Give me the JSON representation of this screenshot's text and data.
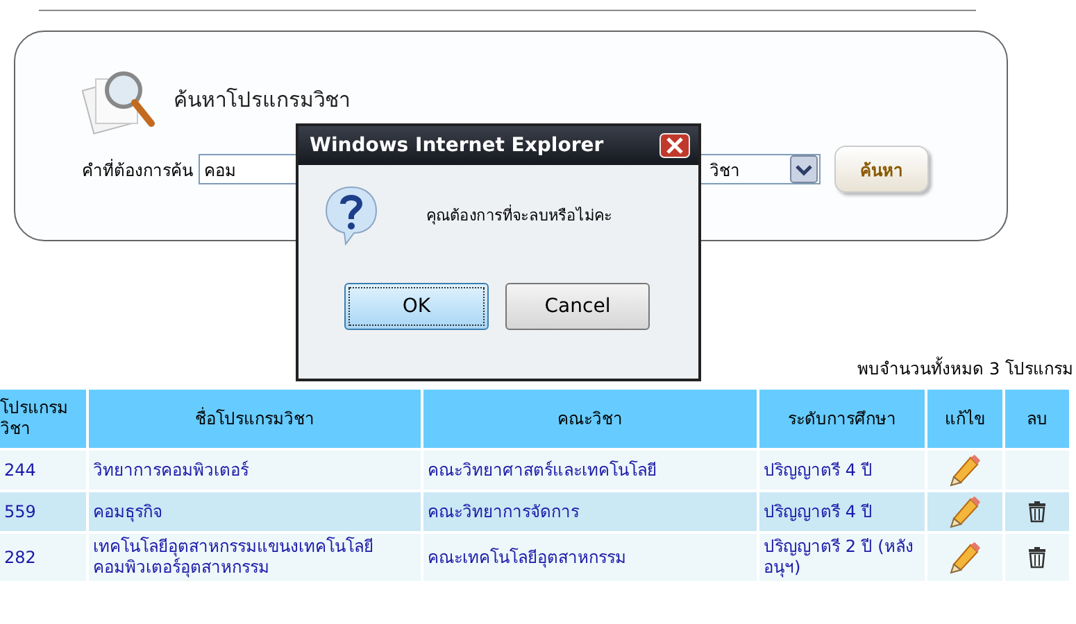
{
  "search_panel": {
    "title": "ค้นหาโปรแกรมวิชา",
    "label": "คำที่ต้องการค้น",
    "query": "คอม",
    "select_value": "วิชา",
    "button": "ค้นหา"
  },
  "dialog": {
    "title": "Windows Internet Explorer",
    "message": "คุณต้องการที่จะลบหรือไม่คะ",
    "buttons": [
      {
        "label": "OK",
        "selected": true
      },
      {
        "label": "Cancel",
        "selected": false
      }
    ]
  },
  "result_count": "พบจำนวนทั้งหมด  3 โปรแกรม",
  "table": {
    "columns": [
      "โปรแกรมวิชา",
      "ชื่อโปรแกรมวิชา",
      "คณะวิชา",
      "ระดับการศึกษา",
      "แก้ไข",
      "ลบ"
    ],
    "rows": [
      {
        "code": "244",
        "name": "วิทยาการคอมพิวเตอร์",
        "faculty": "คณะวิทยาศาสตร์และเทคโนโลยี",
        "level": "ปริญญาตรี 4 ปี",
        "editable": true,
        "deletable": false
      },
      {
        "code": "559",
        "name": "คอมธุรกิจ",
        "faculty": "คณะวิทยาการจัดการ",
        "level": "ปริญญาตรี 4 ปี",
        "editable": true,
        "deletable": true
      },
      {
        "code": "282",
        "name": "เทคโนโลยีอุตสาหกรรมแขนงเทคโนโลยีคอมพิวเตอร์อุตสาหกรรม",
        "faculty": "คณะเทคโนโลยีอุตสาหกรรม",
        "level": "ปริญญาตรี 2 ปี (หลังอนุฯ)",
        "editable": true,
        "deletable": true
      }
    ]
  }
}
